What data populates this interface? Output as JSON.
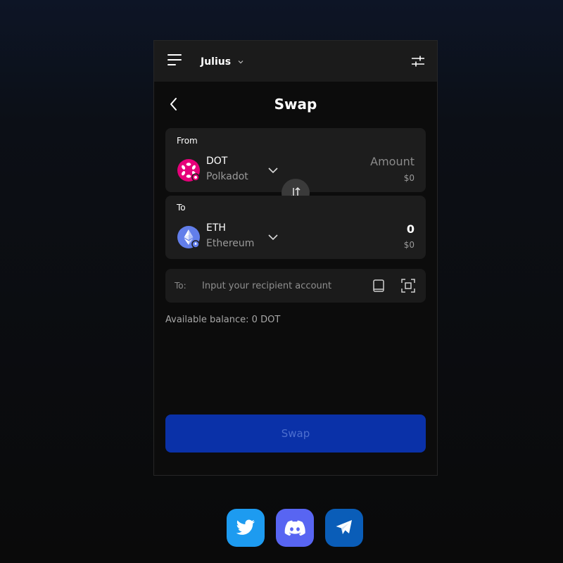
{
  "header": {
    "account_name": "Julius"
  },
  "page": {
    "title": "Swap"
  },
  "from": {
    "label": "From",
    "token_symbol": "DOT",
    "token_name": "Polkadot",
    "token_icon": "polkadot-icon",
    "amount_placeholder": "Amount",
    "usd_value": "$0"
  },
  "to": {
    "label": "To",
    "token_symbol": "ETH",
    "token_name": "Ethereum",
    "token_icon": "ethereum-icon",
    "amount": "0",
    "usd_value": "$0"
  },
  "recipient": {
    "label": "To:",
    "placeholder": "Input your recipient account"
  },
  "balance": {
    "text": "Available balance: 0 DOT"
  },
  "swap_button": {
    "label": "Swap"
  },
  "social": [
    "twitter-icon",
    "discord-icon",
    "telegram-icon"
  ],
  "colors": {
    "accent": "#0a31a8",
    "polkadot": "#e6007a",
    "ethereum": "#627eea",
    "twitter": "#1d9bf0",
    "discord": "#5865f2",
    "telegram": "#0a5db8"
  }
}
